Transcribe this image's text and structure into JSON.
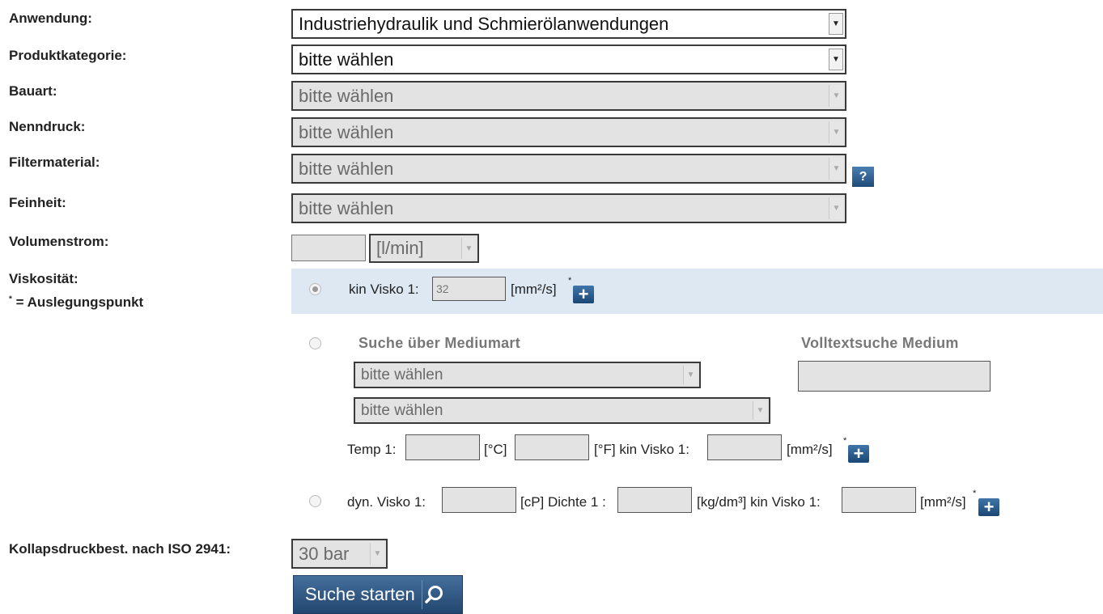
{
  "labels": {
    "anwendung": "Anwendung:",
    "produktkategorie": "Produktkategorie:",
    "bauart": "Bauart:",
    "nenndruck": "Nenndruck:",
    "filtermaterial": "Filtermaterial:",
    "feinheit": "Feinheit:",
    "volumenstrom": "Volumenstrom:",
    "viskositaet": "Viskosität:",
    "auslegung_star": "*",
    "auslegung": " = Auslegungspunkt",
    "kollaps": "Kollapsdruckbest. nach ISO 2941:"
  },
  "selects": {
    "anwendung": "Industriehydraulik und Schmierölanwendungen",
    "produktkategorie": "bitte wählen",
    "bauart": "bitte wählen",
    "nenndruck": "bitte wählen",
    "filtermaterial": "bitte wählen",
    "feinheit": "bitte wählen",
    "volumenstrom_unit": "[l/min]",
    "medium1": "bitte wählen",
    "medium2": "bitte wählen",
    "kollaps": "30 bar"
  },
  "help_icon": "?",
  "visko": {
    "kin_label": "kin Visko 1:",
    "kin_value": "32",
    "unit_mm2s": "[mm²/s]",
    "star": "*",
    "plus": "+",
    "suche_medium": "Suche über Mediumart",
    "volltext": "Volltextsuche Medium",
    "temp_label": "Temp 1:",
    "unit_c": "[°C]",
    "unit_f": "[°F] kin Visko 1:",
    "dyn_label": "dyn. Visko 1:",
    "unit_cp": "[cP] Dichte 1 :",
    "unit_kg": "[kg/dm³] kin Visko 1:"
  },
  "button": {
    "label": "Suche starten",
    "icon": "search-icon"
  },
  "colors": {
    "highlight": "#dde8f3",
    "button": "#2d5581"
  }
}
